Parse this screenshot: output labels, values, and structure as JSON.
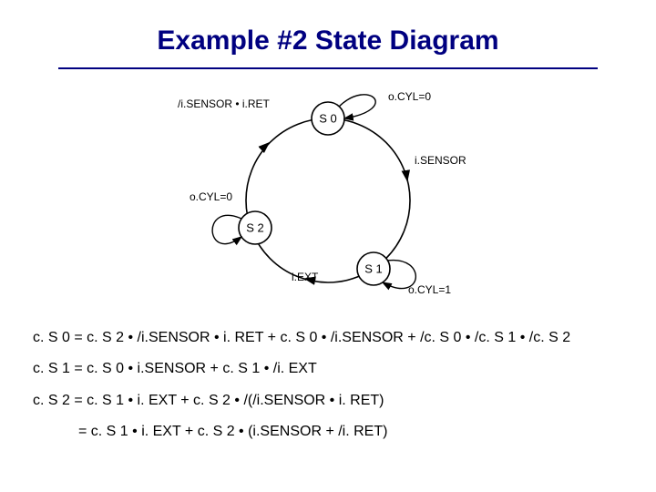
{
  "title": "Example #2 State Diagram",
  "diagram": {
    "states": {
      "s0": "S 0",
      "s1": "S 1",
      "s2": "S 2"
    },
    "edges": {
      "s2_to_s0": "/i.SENSOR • i.RET",
      "s0_self": "o.CYL=0",
      "s0_to_s1": "i.SENSOR",
      "s2_self": "o.CYL=0",
      "s1_to_s2": "i.EXT",
      "s1_self": "o.CYL=1"
    }
  },
  "equations": {
    "eq0": "c. S 0 = c. S 2 • /i.SENSOR • i. RET + c. S 0 • /i.SENSOR + /c. S 0 • /c. S 1 • /c. S 2",
    "eq1": "c. S 1 = c. S 0 • i.SENSOR + c. S 1 • /i. EXT",
    "eq2a": "c. S 2 = c. S 1 • i. EXT + c. S 2 • /(/i.SENSOR • i. RET)",
    "eq2b": "= c. S 1 • i. EXT + c. S 2 • (i.SENSOR + /i. RET)"
  }
}
